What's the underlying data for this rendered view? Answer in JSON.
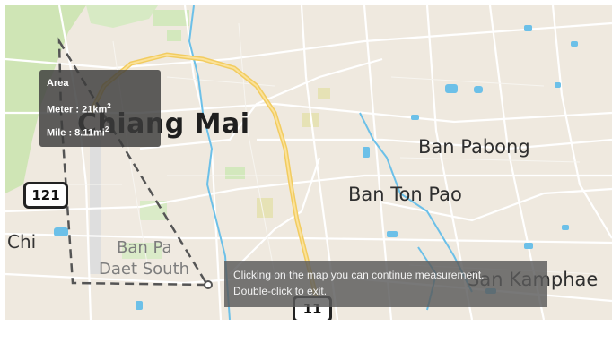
{
  "labels": {
    "city": "Chiang Mai",
    "town_1": "Ban Pabong",
    "town_2": "Ban Ton Pao",
    "town_3": "San Kamphae",
    "village_1": "Ban Pa",
    "village_2": "Daet South",
    "edge_label": "Chi"
  },
  "shields": {
    "route_121": "121",
    "route_11": "11"
  },
  "area_popup": {
    "title": "Area",
    "meter_label": "Meter : 21km",
    "meter_unit_sup": "2",
    "mile_label": "Mile : 8.11mi",
    "mile_unit_sup": "2"
  },
  "tooltip": {
    "line1": "Clicking on the map you can continue measurement.",
    "line2": "Double-click to exit."
  },
  "colors": {
    "map_background": "#efe9df",
    "main_highway": "#f2cc60",
    "water": "#6cc0e8",
    "park": "#cfe5b5",
    "measure_line": "#555555"
  }
}
